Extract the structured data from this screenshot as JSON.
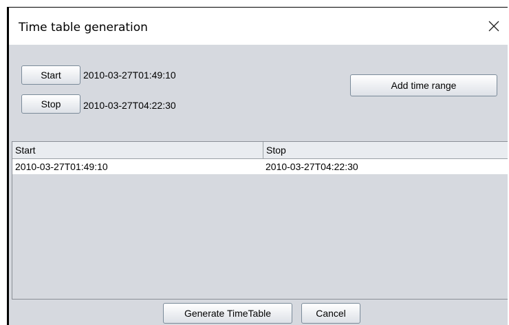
{
  "window": {
    "title": "Time table generation"
  },
  "controls": {
    "start_button": "Start",
    "start_value": "2010-03-27T01:49:10",
    "stop_button": "Stop",
    "stop_value": "2010-03-27T04:22:30",
    "add_button": "Add time range"
  },
  "table": {
    "columns": [
      "Start",
      "Stop"
    ],
    "rows": [
      [
        "2010-03-27T01:49:10",
        "2010-03-27T04:22:30"
      ]
    ]
  },
  "footer": {
    "generate_button": "Generate TimeTable",
    "cancel_button": "Cancel"
  },
  "icons": {
    "close": "close-icon"
  }
}
